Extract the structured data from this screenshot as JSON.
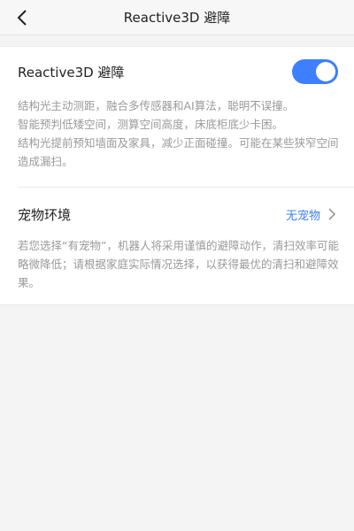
{
  "header": {
    "title": "Reactive3D 避障"
  },
  "reactive": {
    "label": "Reactive3D 避障",
    "enabled": true,
    "desc": [
      "结构光主动测距，融合多传感器和AI算法，聪明不误撞。",
      "智能预判低矮空间，测算空间高度，床底柜底少卡困。",
      "结构光提前预知墙面及家具，减少正面碰撞。可能在某些狭窄空间造成漏扫。"
    ]
  },
  "pet": {
    "label": "宠物环境",
    "value": "无宠物",
    "desc": "若您选择“有宠物”，机器人将采用谨慎的避障动作，清扫效率可能略微降低；请根据家庭实际情况选择，以获得最优的清扫和避障效果。"
  },
  "colors": {
    "accent": "#3d7fff"
  }
}
